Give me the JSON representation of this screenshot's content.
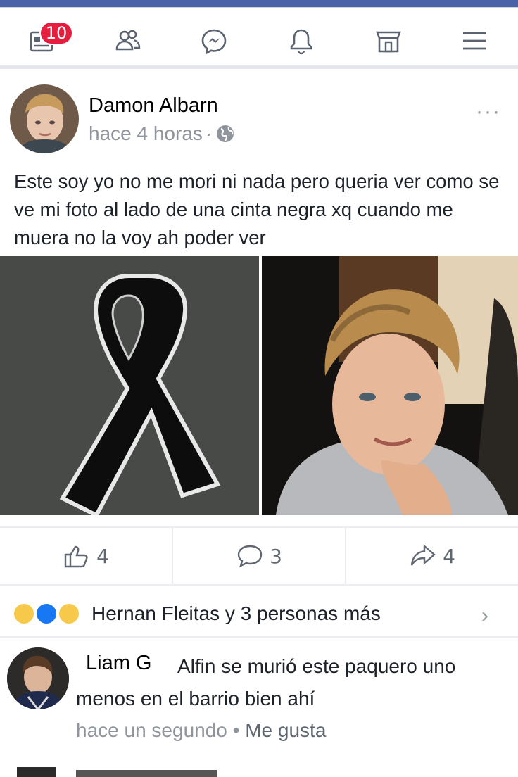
{
  "nav": {
    "notification_count": "10",
    "items": [
      "news-feed",
      "friends",
      "messenger",
      "notifications",
      "marketplace",
      "menu"
    ]
  },
  "post": {
    "author": "Damon Albarn",
    "time": "hace 4 horas",
    "separator": "·",
    "privacy_icon": "globe-icon",
    "more_label": "···",
    "text": "Este soy yo no me mori ni nada pero queria ver como se ve mi foto al lado de una cinta negra xq cuando me muera no la voy ah poder ver",
    "actions": {
      "likes": "4",
      "comments": "3",
      "shares": "4"
    },
    "reactions_summary": "Hernan Fleitas y 3 personas más",
    "reaction_icons": [
      "sad-icon",
      "like-icon",
      "haha-icon"
    ]
  },
  "comment": {
    "author": "Liam G",
    "text": "Alfin se murió este paquero uno menos en el barrio bien ahí",
    "time": "hace un segundo",
    "dot": "•",
    "like_label": "Me gusta"
  },
  "colors": {
    "brand": "#4a63a8",
    "badge": "#e41e3f",
    "muted": "#90949c",
    "like_blue": "#1877f2"
  }
}
